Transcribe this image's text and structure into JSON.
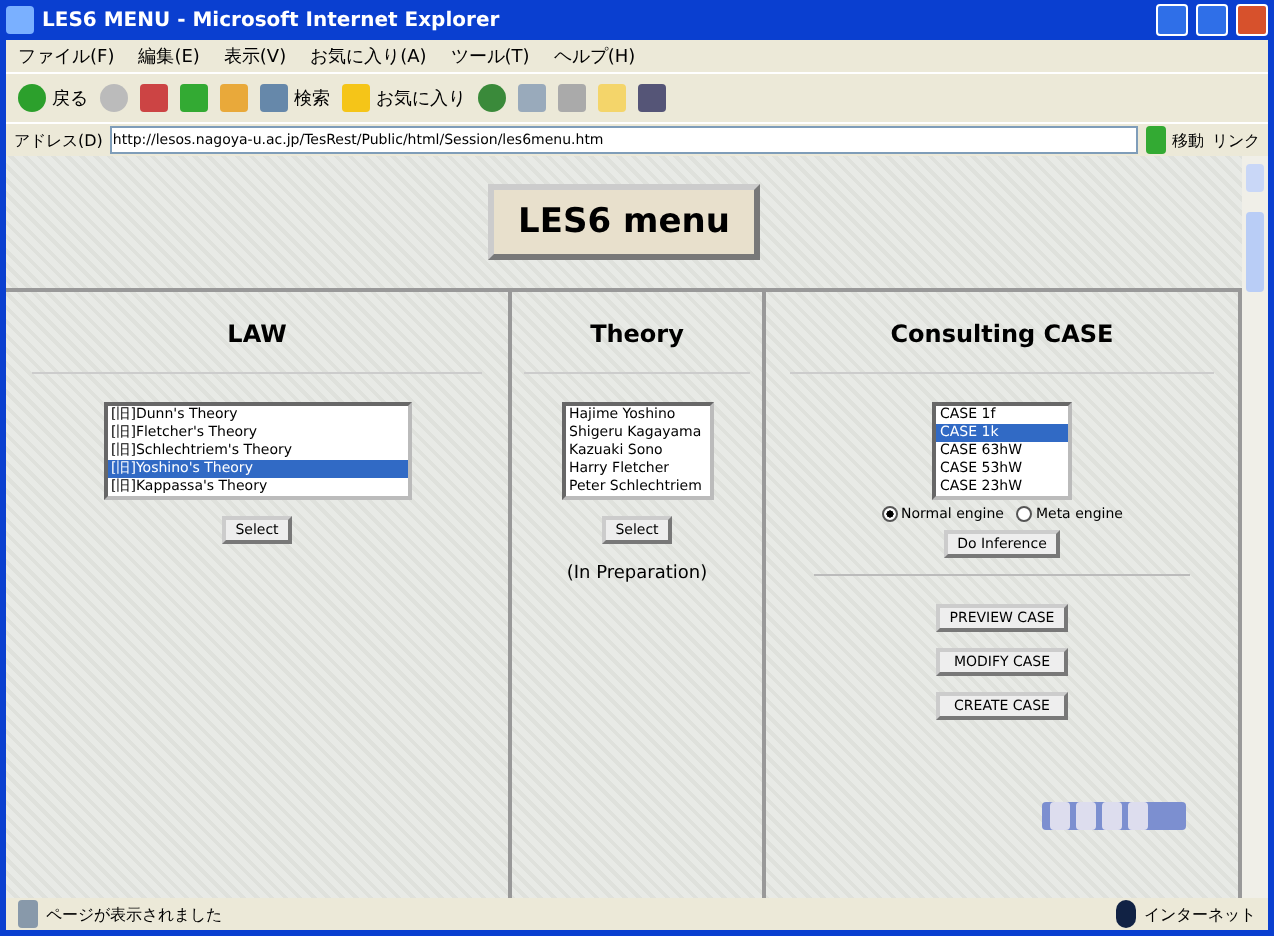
{
  "window": {
    "title": "LES6 MENU - Microsoft Internet Explorer"
  },
  "menu_bar": [
    "ファイル(F)",
    "編集(E)",
    "表示(V)",
    "お気に入り(A)",
    "ツール(T)",
    "ヘルプ(H)"
  ],
  "toolbar": {
    "back": "戻る",
    "search": "検索",
    "favorites": "お気に入り"
  },
  "address_bar": {
    "label": "アドレス(D)",
    "value": "http://lesos.nagoya-u.ac.jp/TesRest/Public/html/Session/les6menu.htm",
    "go": "移動",
    "links": "リンク"
  },
  "header": {
    "title": "LES6 menu"
  },
  "law": {
    "heading": "LAW",
    "items": [
      {
        "label": "[旧]Dunn's Theory",
        "selected": false
      },
      {
        "label": "[旧]Fletcher's Theory",
        "selected": false
      },
      {
        "label": "[旧]Schlechtriem's Theory",
        "selected": false
      },
      {
        "label": "[旧]Yoshino's Theory",
        "selected": true
      },
      {
        "label": "[旧]Kappassa's Theory",
        "selected": false
      }
    ],
    "button": "Select"
  },
  "theory": {
    "heading": "Theory",
    "items": [
      {
        "label": "Hajime Yoshino",
        "selected": false
      },
      {
        "label": "Shigeru Kagayama",
        "selected": false
      },
      {
        "label": "Kazuaki Sono",
        "selected": false
      },
      {
        "label": "Harry Fletcher",
        "selected": false
      },
      {
        "label": "Peter Schlechtriem",
        "selected": false
      }
    ],
    "button": "Select",
    "note": "(In Preparation)"
  },
  "consulting": {
    "heading": "Consulting CASE",
    "items": [
      {
        "label": "CASE 1f",
        "selected": false
      },
      {
        "label": "CASE 1k",
        "selected": true
      },
      {
        "label": "CASE 63hW",
        "selected": false
      },
      {
        "label": "CASE 53hW",
        "selected": false
      },
      {
        "label": "CASE 23hW",
        "selected": false
      }
    ],
    "engines": [
      {
        "label": "Normal engine",
        "selected": true
      },
      {
        "label": "Meta engine",
        "selected": false
      }
    ],
    "inference_button": "Do Inference",
    "case_buttons": [
      "PREVIEW CASE",
      "MODIFY CASE",
      "CREATE CASE"
    ]
  },
  "status_bar": {
    "message": "ページが表示されました",
    "zone": "インターネット"
  }
}
